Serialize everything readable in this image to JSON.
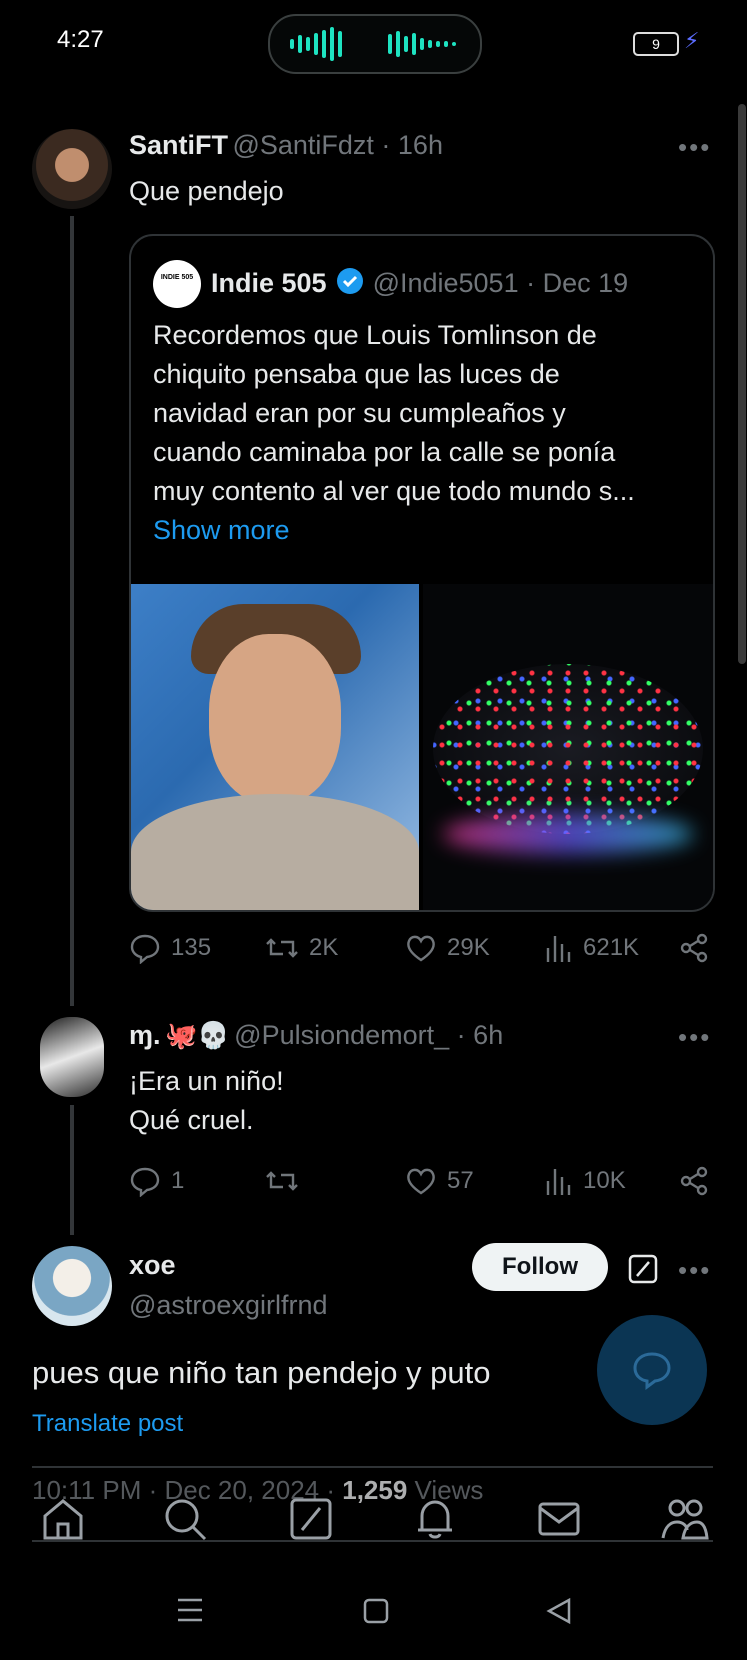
{
  "status_bar": {
    "time": "4:27",
    "battery": "9"
  },
  "main_tweet": {
    "name": "SantiFT",
    "handle": "@SantiFdzt · 16h",
    "text": "Que pendejo",
    "quote": {
      "name": "Indie 505",
      "avatar_text": "INDIE 505",
      "handle": "@Indie5051 · Dec 19",
      "lines": [
        "Recordemos que Louis Tomlinson de",
        "chiquito pensaba que las luces de",
        "navidad eran por su cumpleaños y",
        "cuando caminaba por la calle se ponía",
        "muy contento al ver que todo mundo s..."
      ],
      "show_more": "Show more"
    },
    "stats": {
      "replies": "135",
      "reposts": "2K",
      "likes": "29K",
      "views": "621K"
    }
  },
  "reply_tweet": {
    "name": "ɱ.",
    "emojis": "🐙💀",
    "handle": "@Pulsiondemort_ · 6h",
    "lines": [
      "¡Era un niño!",
      "Qué cruel."
    ],
    "stats": {
      "replies": "1",
      "likes": "57",
      "views": "10K"
    }
  },
  "focus_tweet": {
    "name": "xoe",
    "handle": "@astroexgirlfrnd",
    "follow_label": "Follow",
    "text": "pues que niño tan pendejo y puto",
    "translate": "Translate post",
    "time": "10:11 PM · Dec 20, 2024 · ",
    "views_count": "1,259",
    "views_label": " Views"
  },
  "more_glyph": "•••",
  "colors": {
    "accent": "#1d9bf0",
    "background": "#000000",
    "muted": "#71767b",
    "fab": "#0b3553"
  }
}
